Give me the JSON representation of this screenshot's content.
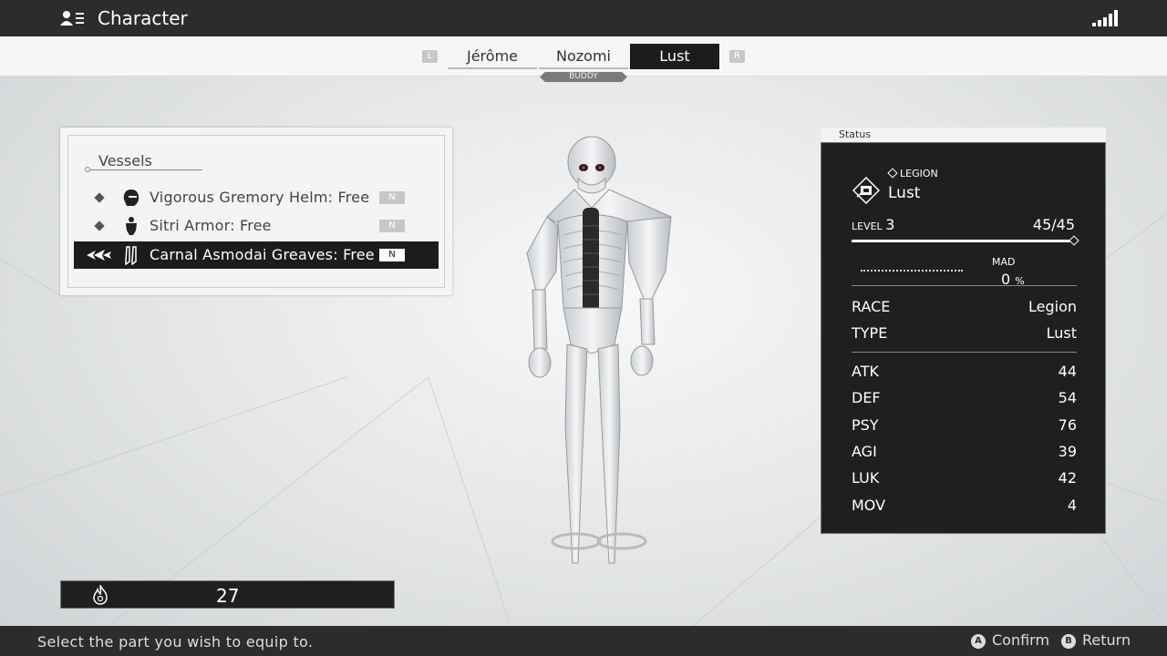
{
  "header": {
    "title": "Character",
    "icon": "profile-card-icon",
    "signal_icon": "signal-bars-icon"
  },
  "tabs": {
    "left_button": "L",
    "right_button": "R",
    "items": [
      {
        "label": "Jérôme"
      },
      {
        "label": "Nozomi"
      },
      {
        "label": "Lust"
      }
    ],
    "active_index": 2,
    "buddy_label": "BUDDY"
  },
  "vessels": {
    "title": "Vessels",
    "items": [
      {
        "label": "Vigorous Gremory Helm: Free",
        "badge": "N",
        "icon": "helm-icon",
        "selected": false
      },
      {
        "label": "Sitri Armor: Free",
        "badge": "N",
        "icon": "armor-icon",
        "selected": false
      },
      {
        "label": "Carnal Asmodai Greaves: Free",
        "badge": "N",
        "icon": "greaves-icon",
        "selected": true
      }
    ]
  },
  "counter": {
    "icon": "flame-icon",
    "value": "27"
  },
  "status": {
    "header": "Status",
    "race_tag": "LEGION",
    "name": "Lust",
    "level_label": "LEVEL",
    "level_value": "3",
    "hp": "45/45",
    "hp_fraction": 1.0,
    "mad_label": "MAD",
    "mad_value": "0",
    "mad_unit": "%",
    "race_label": "RACE",
    "race_value": "Legion",
    "type_label": "TYPE",
    "type_value": "Lust",
    "stats": [
      {
        "key": "ATK",
        "value": "44"
      },
      {
        "key": "DEF",
        "value": "54"
      },
      {
        "key": "PSY",
        "value": "76"
      },
      {
        "key": "AGI",
        "value": "39"
      },
      {
        "key": "LUK",
        "value": "42"
      },
      {
        "key": "MOV",
        "value": "4"
      }
    ]
  },
  "footer": {
    "hint": "Select the part you wish to equip to.",
    "confirm_button": "A",
    "confirm_label": "Confirm",
    "return_button": "B",
    "return_label": "Return"
  },
  "colors": {
    "panel_dark": "#1f1f1f",
    "bar": "#2c2c2c",
    "highlight": "#ffffff"
  }
}
